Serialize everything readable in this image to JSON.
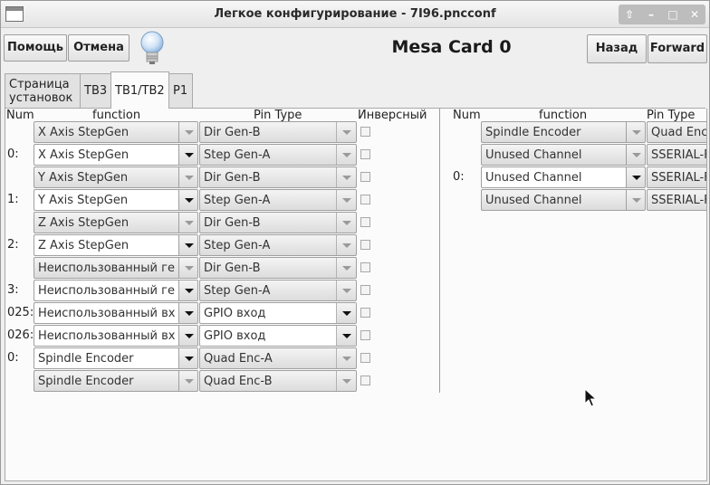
{
  "window": {
    "title": "Легкое конфигурирование - 7I96.pncconf"
  },
  "toolbar": {
    "help_label": "Помощь",
    "cancel_label": "Отмена",
    "back_label": "Назад",
    "forward_label": "Forward",
    "card_title": "Mesa Card 0"
  },
  "tabs": [
    {
      "label": "Страница установок"
    },
    {
      "label": "TB3"
    },
    {
      "label": "TB1/TB2"
    },
    {
      "label": "P1"
    }
  ],
  "left_table": {
    "headers": {
      "num": "Num",
      "function": "function",
      "pin_type": "Pin Type",
      "inverse": "Инверсный"
    },
    "rows": [
      {
        "num": "",
        "function": "X Axis StepGen",
        "pin_type": "Dir Gen-B"
      },
      {
        "num": "0:",
        "function": "X Axis StepGen",
        "pin_type": "Step Gen-A"
      },
      {
        "num": "",
        "function": "Y Axis StepGen",
        "pin_type": "Dir Gen-B"
      },
      {
        "num": "1:",
        "function": "Y Axis StepGen",
        "pin_type": "Step Gen-A"
      },
      {
        "num": "",
        "function": "Z Axis StepGen",
        "pin_type": "Dir Gen-B"
      },
      {
        "num": "2:",
        "function": "Z Axis StepGen",
        "pin_type": "Step Gen-A"
      },
      {
        "num": "",
        "function": "Неиспользованный ге",
        "pin_type": "Dir Gen-B"
      },
      {
        "num": "3:",
        "function": "Неиспользованный ге",
        "pin_type": "Step Gen-A"
      },
      {
        "num": "025:",
        "function": "Неиспользованный вх",
        "pin_type": "GPIO вход"
      },
      {
        "num": "026:",
        "function": "Неиспользованный вх",
        "pin_type": "GPIO вход"
      },
      {
        "num": "0:",
        "function": "Spindle Encoder",
        "pin_type": "Quad Enc-A"
      },
      {
        "num": "",
        "function": "Spindle Encoder",
        "pin_type": "Quad Enc-B"
      }
    ]
  },
  "right_table": {
    "headers": {
      "num": "Num",
      "function": "function",
      "pin_type": "Pin Type"
    },
    "rows": [
      {
        "num": "",
        "function": "Spindle Encoder",
        "pin_type": "Quad Enc-"
      },
      {
        "num": "",
        "function": "Unused Channel",
        "pin_type": "SSERIAL-F"
      },
      {
        "num": "0:",
        "function": "Unused Channel",
        "pin_type": "SSERIAL-F"
      },
      {
        "num": "",
        "function": "Unused Channel",
        "pin_type": "SSERIAL-F"
      }
    ]
  }
}
